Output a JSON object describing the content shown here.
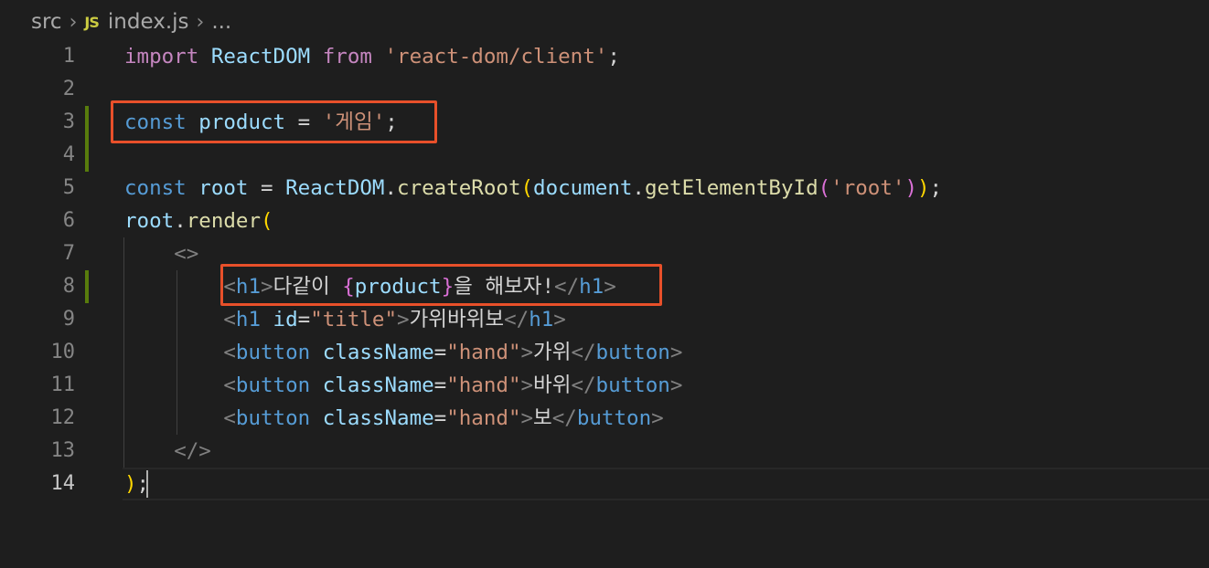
{
  "breadcrumb": {
    "folder": "src",
    "file_icon": "JS",
    "file": "index.js",
    "more": "..."
  },
  "editor": {
    "line_numbers": [
      "1",
      "2",
      "3",
      "4",
      "5",
      "6",
      "7",
      "8",
      "9",
      "10",
      "11",
      "12",
      "13",
      "14"
    ],
    "active_line": "14",
    "lines": {
      "l1": {
        "import": "import",
        "name": "ReactDOM",
        "from": "from",
        "source": "'react-dom/client'",
        "semi": ";"
      },
      "l3": {
        "kw": "const",
        "name": "product",
        "eq": " = ",
        "value": "'게임'",
        "semi": ";"
      },
      "l5": {
        "kw": "const",
        "name": "root",
        "eq": " = ",
        "obj": "ReactDOM",
        "dot": ".",
        "method": "createRoot",
        "open": "(",
        "doc": "document",
        "dot2": ".",
        "method2": "getElementById",
        "open2": "(",
        "arg": "'root'",
        "close2": ")",
        "close": ")",
        "semi": ";"
      },
      "l6": {
        "obj": "root",
        "dot": ".",
        "method": "render",
        "open": "("
      },
      "l7": {
        "frag": "<>"
      },
      "l8": {
        "lt": "<",
        "tag": "h1",
        "gt": ">",
        "text1": "다같이 ",
        "bopen": "{",
        "expr": "product",
        "bclose": "}",
        "text2": "을 해보자!",
        "lt2": "</",
        "tag2": "h1",
        "gt2": ">"
      },
      "l9": {
        "lt": "<",
        "tag": "h1",
        "attr": " id",
        "eq": "=",
        "val": "\"title\"",
        "gt": ">",
        "text": "가위바위보",
        "lt2": "</",
        "tag2": "h1",
        "gt2": ">"
      },
      "l10": {
        "lt": "<",
        "tag": "button",
        "attr": " className",
        "eq": "=",
        "val": "\"hand\"",
        "gt": ">",
        "text": "가위",
        "lt2": "</",
        "tag2": "button",
        "gt2": ">"
      },
      "l11": {
        "lt": "<",
        "tag": "button",
        "attr": " className",
        "eq": "=",
        "val": "\"hand\"",
        "gt": ">",
        "text": "바위",
        "lt2": "</",
        "tag2": "button",
        "gt2": ">"
      },
      "l12": {
        "lt": "<",
        "tag": "button",
        "attr": " className",
        "eq": "=",
        "val": "\"hand\"",
        "gt": ">",
        "text": "보",
        "lt2": "</",
        "tag2": "button",
        "gt2": ">"
      },
      "l13": {
        "frag": "</>"
      },
      "l14": {
        "close": ")",
        "semi": ";"
      }
    }
  },
  "colors": {
    "annotation_box": "#e8502a",
    "modified_gutter": "#587c0c",
    "background": "#1e1e1e"
  }
}
